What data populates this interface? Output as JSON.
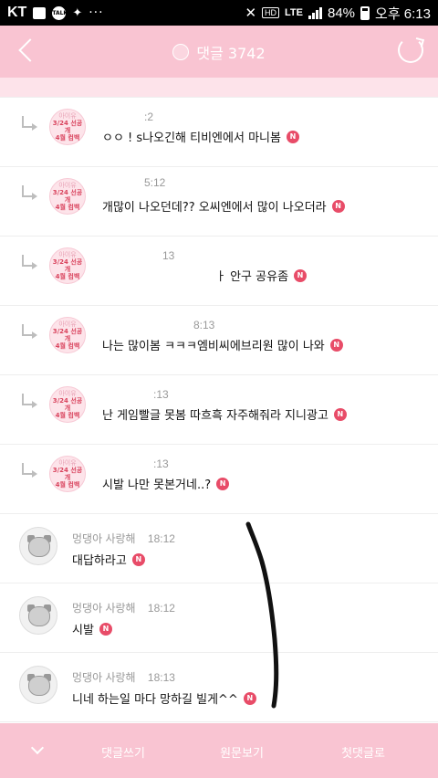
{
  "status_bar": {
    "carrier": "KT",
    "battery": "84%",
    "time_label": "오후 6:13",
    "network": "LTE",
    "hd": "HD",
    "talk_icon": "TALK"
  },
  "header": {
    "title": "댓글 3742"
  },
  "replies": [
    {
      "badge": [
        "아이유",
        "3/24 선공개",
        "4월 컴백"
      ],
      "time": ":2",
      "text": "ㅇㅇ ! s나오긴해 티비엔에서 마니봄",
      "n": "N"
    },
    {
      "badge": [
        "아이유",
        "3/24 선공개",
        "4월 컴백"
      ],
      "time": "5:12",
      "text": "개많이 나오던데?? 오씨엔에서 많이 나오더라",
      "n": "N"
    },
    {
      "badge": [
        "아이유",
        "3/24 선공개",
        "4월 컴백"
      ],
      "time": "13",
      "text": "ㅏ 안구 공유좀",
      "n": "N"
    },
    {
      "badge": [
        "아이유",
        "3/24 선공개",
        "4월 컴백"
      ],
      "time": "8:13",
      "text": "나는 많이봄 ㅋㅋㅋ엠비씨에브리원 많이 나와",
      "n": "N"
    },
    {
      "badge": [
        "아이유",
        "3/24 선공개",
        "4월 컴백"
      ],
      "time": ":13",
      "text": "난 게임빨글 못봄 따흐흑 자주해줘라 지니광고",
      "n": "N"
    },
    {
      "badge": [
        "아이유",
        "3/24 선공개",
        "4월 컴백"
      ],
      "time": ":13",
      "text": "시발 나만 못본거네..?",
      "n": "N"
    }
  ],
  "comments": [
    {
      "name": "멍댕아 사랑해",
      "time": "18:12",
      "text": "대답하라고",
      "n": "N"
    },
    {
      "name": "멍댕아 사랑해",
      "time": "18:12",
      "text": "시발",
      "n": "N"
    },
    {
      "name": "멍댕아 사랑해",
      "time": "18:13",
      "text": "니네 하는일 마다 망하길 빌게^^",
      "n": "N"
    }
  ],
  "bottom_bar": {
    "write": "댓글쓰기",
    "article": "원문보기",
    "first": "첫댓글로"
  },
  "colors": {
    "accent": "#f9c4d2",
    "new_badge": "#e84c68"
  }
}
